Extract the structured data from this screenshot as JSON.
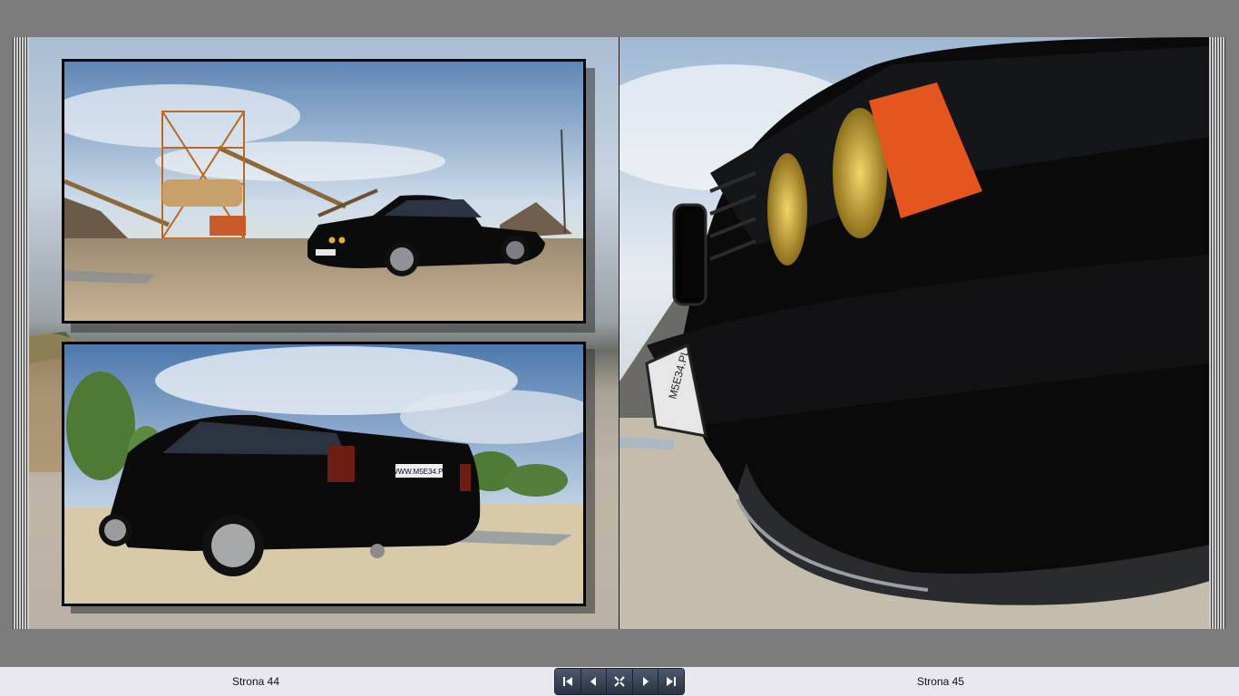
{
  "book": {
    "left_page_label": "Strona 44",
    "right_page_label": "Strona 45"
  },
  "navigation": {
    "buttons": [
      "first-page-icon",
      "prev-page-icon",
      "fit-page-icon",
      "next-page-icon",
      "last-page-icon"
    ]
  },
  "photo_text": {
    "plate_rear": "WWW.M5E34.PL",
    "plate_front": "M5E34.PL"
  },
  "colors": {
    "background": "#7c7c7c",
    "bottom_bar": "#e8e8ee",
    "nav_bar": "#3a4556",
    "car_body": "#0b0b0c",
    "fog_lamp": "#d8b23a",
    "indicator": "#e5561e"
  }
}
